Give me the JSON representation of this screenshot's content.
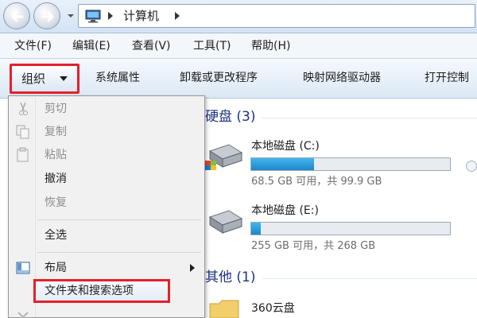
{
  "address": {
    "breadcrumb": "计算机"
  },
  "menubar": {
    "items": [
      "文件(F)",
      "编辑(E)",
      "查看(V)",
      "工具(T)",
      "帮助(H)"
    ]
  },
  "toolbar": {
    "organize_label": "组织",
    "commands": [
      "系统属性",
      "卸载或更改程序",
      "映射网络驱动器",
      "打开控制"
    ]
  },
  "content": {
    "group_hard_disks": "硬盘 (3)",
    "drives": [
      {
        "name": "本地磁盘 (C:)",
        "info": "68.5 GB 可用，共 99.9 GB",
        "used_fraction": 0.314
      },
      {
        "name": "本地磁盘 (E:)",
        "info": "255 GB 可用，共 268 GB",
        "used_fraction": 0.049
      }
    ],
    "group_other": "其他 (1)",
    "other_items": [
      {
        "name": "360云盘"
      }
    ]
  },
  "organize_menu": {
    "items": [
      {
        "label": "剪切",
        "enabled": false,
        "icon": "scissors-icon"
      },
      {
        "label": "复制",
        "enabled": false,
        "icon": "copy-icon"
      },
      {
        "label": "粘贴",
        "enabled": false,
        "icon": "paste-icon"
      },
      {
        "label": "撤消",
        "enabled": true,
        "icon": ""
      },
      {
        "label": "恢复",
        "enabled": false,
        "icon": ""
      },
      {
        "label": "全选",
        "enabled": true,
        "icon": ""
      },
      {
        "label": "布局",
        "enabled": true,
        "icon": "layout-icon",
        "submenu": true
      },
      {
        "label": "文件夹和搜索选项",
        "enabled": true,
        "icon": "",
        "highlighted": true
      }
    ]
  },
  "colors": {
    "highlight_box": "#e5202a",
    "drive_fill": "#1f86c9",
    "group_header": "#1e3287"
  }
}
